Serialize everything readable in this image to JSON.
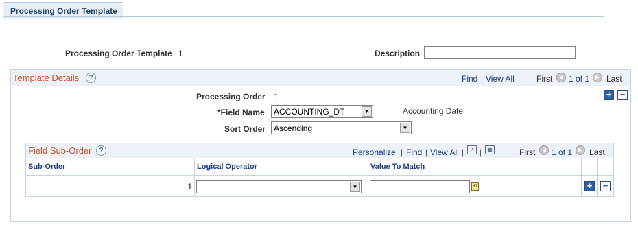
{
  "page": {
    "tab_label": "Processing Order Template"
  },
  "header": {
    "template_label": "Processing Order Template",
    "template_value": "1",
    "description_label": "Description",
    "description_value": ""
  },
  "template_details": {
    "title": "Template Details",
    "help": "?",
    "find": "Find",
    "separator": "|",
    "view_all": "View All",
    "first": "First",
    "range": "1 of 1",
    "last": "Last",
    "processing_order_label": "Processing Order",
    "processing_order_value": "1",
    "field_name_label": "*Field Name",
    "field_name_value": "ACCOUNTING_DT",
    "field_name_desc": "Accounting Date",
    "sort_order_label": "Sort Order",
    "sort_order_value": "Ascending",
    "add": "+",
    "remove": "−"
  },
  "field_sub_order": {
    "title": "Field Sub-Order",
    "help": "?",
    "personalize": "Personalize",
    "find": "Find",
    "separator": "|",
    "view_all": "View All",
    "first": "First",
    "range": "1 of 1",
    "last": "Last",
    "columns": [
      "Sub-Order",
      "Logical Operator",
      "Value To Match"
    ],
    "rows": [
      {
        "sub_order": "1",
        "logical_operator": "",
        "value_to_match": ""
      }
    ],
    "add": "+",
    "remove": "−"
  },
  "icons": {
    "prev": "◀",
    "next": "▶",
    "dropdown": "▼",
    "zoom": "↗",
    "download": "▦",
    "calendar": "31"
  }
}
